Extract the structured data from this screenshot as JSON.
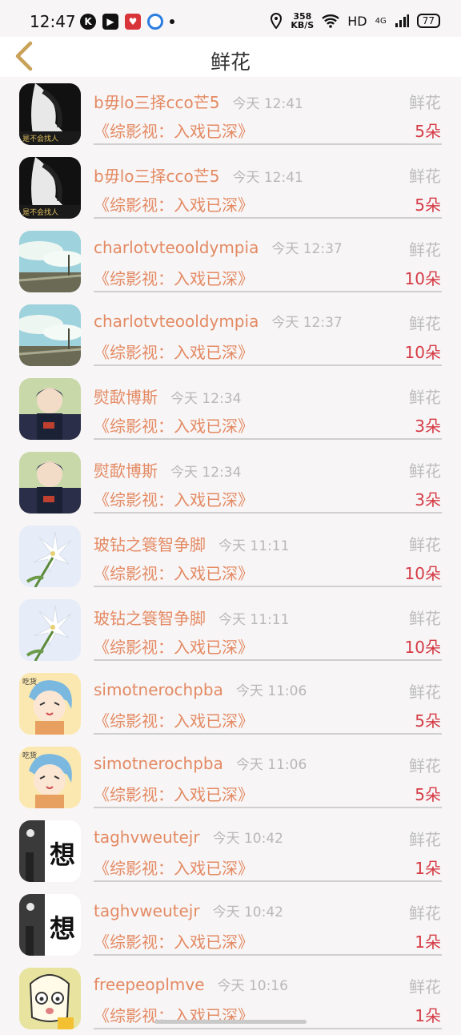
{
  "status_bar": {
    "time": "12:47",
    "net_speed_value": "358",
    "net_speed_unit": "KB/S",
    "network": "HD",
    "signal": "4G",
    "battery": "77"
  },
  "header": {
    "title": "鲜花",
    "back_icon": "chevron-left-icon"
  },
  "colors": {
    "accent": "#e48a63",
    "count": "#d63b45",
    "muted": "#b8b8b8"
  },
  "records": [
    {
      "name": "b毋lo三择cco芒5",
      "time": "今天 12:41",
      "kind": "鲜花",
      "book": "《综影视：入戏已深》",
      "count": "5朵",
      "avatar": "dark-portrait"
    },
    {
      "name": "b毋lo三择cco芒5",
      "time": "今天 12:41",
      "kind": "鲜花",
      "book": "《综影视：入戏已深》",
      "count": "5朵",
      "avatar": "dark-portrait"
    },
    {
      "name": "charlotvteooldympia",
      "time": "今天 12:37",
      "kind": "鲜花",
      "book": "《综影视：入戏已深》",
      "count": "10朵",
      "avatar": "sky-landscape"
    },
    {
      "name": "charlotvteooldympia",
      "time": "今天 12:37",
      "kind": "鲜花",
      "book": "《综影视：入戏已深》",
      "count": "10朵",
      "avatar": "sky-landscape"
    },
    {
      "name": "熨歃博斯",
      "time": "今天 12:34",
      "kind": "鲜花",
      "book": "《综影视：入戏已深》",
      "count": "3朵",
      "avatar": "anime-boy"
    },
    {
      "name": "熨歃博斯",
      "time": "今天 12:34",
      "kind": "鲜花",
      "book": "《综影视：入戏已深》",
      "count": "3朵",
      "avatar": "anime-boy"
    },
    {
      "name": "玻钻之簑智争脚",
      "time": "今天 11:11",
      "kind": "鲜花",
      "book": "《综影视：入戏已深》",
      "count": "10朵",
      "avatar": "white-lily"
    },
    {
      "name": "玻钻之簑智争脚",
      "time": "今天 11:11",
      "kind": "鲜花",
      "book": "《综影视：入戏已深》",
      "count": "10朵",
      "avatar": "white-lily"
    },
    {
      "name": "simotnerochpba",
      "time": "今天 11:06",
      "kind": "鲜花",
      "book": "《综影视：入戏已深》",
      "count": "5朵",
      "avatar": "cartoon-girl"
    },
    {
      "name": "simotnerochpba",
      "time": "今天 11:06",
      "kind": "鲜花",
      "book": "《综影视：入戏已深》",
      "count": "5朵",
      "avatar": "cartoon-girl"
    },
    {
      "name": "taghvweutejr",
      "time": "今天 10:42",
      "kind": "鲜花",
      "book": "《综影视：入戏已深》",
      "count": "1朵",
      "avatar": "xiang-text",
      "avatar_text": "想"
    },
    {
      "name": "taghvweutejr",
      "time": "今天 10:42",
      "kind": "鲜花",
      "book": "《综影视：入戏已深》",
      "count": "1朵",
      "avatar": "xiang-text",
      "avatar_text": "想"
    },
    {
      "name": "freepeoplmve",
      "time": "今天 10:16",
      "kind": "鲜花",
      "book": "《综影视：入戏已深》",
      "count": "1朵",
      "avatar": "cartoon-face"
    }
  ]
}
